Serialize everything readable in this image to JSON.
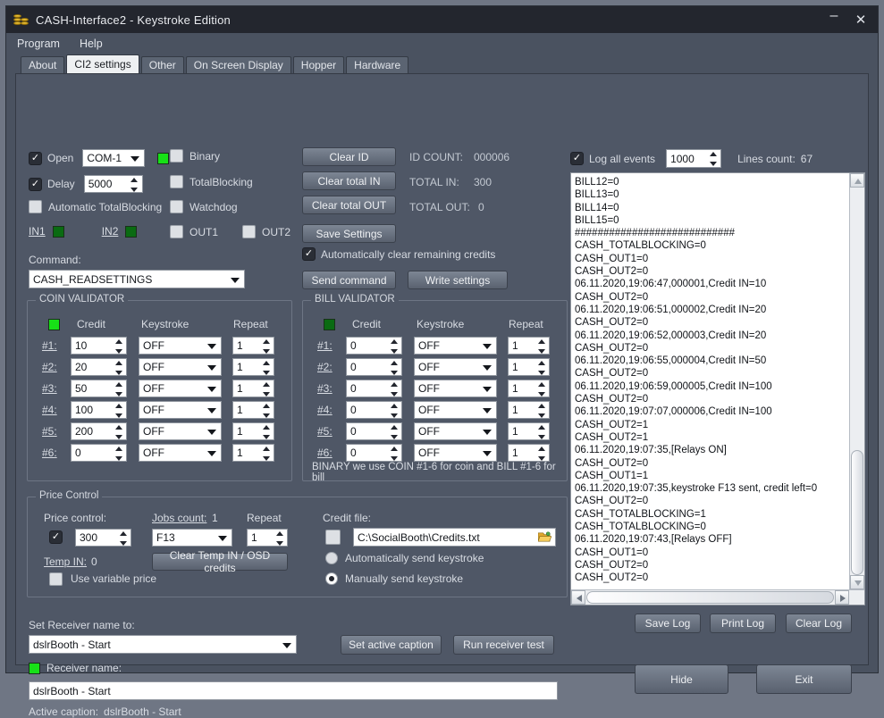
{
  "window": {
    "title": "CASH-Interface2 - Keystroke Edition",
    "icon": "coin-stack-icon",
    "minimize": "–",
    "close": "✕"
  },
  "menu": {
    "items": [
      "Program",
      "Help"
    ]
  },
  "tabs": {
    "items": [
      "About",
      "CI2 settings",
      "Other",
      "On Screen Display",
      "Hopper",
      "Hardware"
    ],
    "active": "CI2 settings"
  },
  "connection": {
    "open_label": "Open",
    "open_checked": "✓",
    "port_value": "COM-1",
    "port_led": "on",
    "delay_label": "Delay",
    "delay_checked": "✓",
    "delay_value": "5000",
    "auto_totalblocking_label": "Automatic TotalBlocking",
    "in1_label": "IN1",
    "in2_label": "IN2",
    "binary_label": "Binary",
    "totalblocking_label": "TotalBlocking",
    "watchdog_label": "Watchdog",
    "out1_label": "OUT1",
    "out2_label": "OUT2",
    "command_label": "Command:",
    "command_value": "CASH_READSETTINGS"
  },
  "actions": {
    "clear_id": "Clear ID",
    "clear_total_in": "Clear total IN",
    "clear_total_out": "Clear total OUT",
    "save_settings": "Save Settings",
    "auto_clear_label": "Automatically clear remaining credits",
    "auto_clear_checked": "✓",
    "send_command": "Send command",
    "write_settings": "Write settings"
  },
  "counters": {
    "id_count_label": "ID COUNT:",
    "id_count_value": "000006",
    "total_in_label": "TOTAL IN:",
    "total_in_value": "300",
    "total_out_label": "TOTAL OUT:",
    "total_out_value": "0"
  },
  "coin_validator": {
    "title": "COIN VALIDATOR",
    "led": "on",
    "headers": {
      "credit": "Credit",
      "keystroke": "Keystroke",
      "repeat": "Repeat"
    },
    "rows": [
      {
        "label": "#1:",
        "credit": "10",
        "keystroke": "OFF",
        "repeat": "1"
      },
      {
        "label": "#2:",
        "credit": "20",
        "keystroke": "OFF",
        "repeat": "1"
      },
      {
        "label": "#3:",
        "credit": "50",
        "keystroke": "OFF",
        "repeat": "1"
      },
      {
        "label": "#4:",
        "credit": "100",
        "keystroke": "OFF",
        "repeat": "1"
      },
      {
        "label": "#5:",
        "credit": "200",
        "keystroke": "OFF",
        "repeat": "1"
      },
      {
        "label": "#6:",
        "credit": "0",
        "keystroke": "OFF",
        "repeat": "1"
      }
    ]
  },
  "bill_validator": {
    "title": "BILL VALIDATOR",
    "led": "dim",
    "headers": {
      "credit": "Credit",
      "keystroke": "Keystroke",
      "repeat": "Repeat"
    },
    "rows": [
      {
        "label": "#1:",
        "credit": "0",
        "keystroke": "OFF",
        "repeat": "1"
      },
      {
        "label": "#2:",
        "credit": "0",
        "keystroke": "OFF",
        "repeat": "1"
      },
      {
        "label": "#3:",
        "credit": "0",
        "keystroke": "OFF",
        "repeat": "1"
      },
      {
        "label": "#4:",
        "credit": "0",
        "keystroke": "OFF",
        "repeat": "1"
      },
      {
        "label": "#5:",
        "credit": "0",
        "keystroke": "OFF",
        "repeat": "1"
      },
      {
        "label": "#6:",
        "credit": "0",
        "keystroke": "OFF",
        "repeat": "1"
      }
    ],
    "note": "BINARY we use COIN #1-6 for coin and BILL #1-6 for bill"
  },
  "price_control": {
    "title": "Price Control",
    "price_label": "Price control:",
    "price_checked": "✓",
    "price_value": "300",
    "jobs_label": "Jobs count:",
    "jobs_value": "1",
    "keystroke_value": "F13",
    "repeat_label": "Repeat",
    "repeat_value": "1",
    "temp_in_label": "Temp IN:",
    "temp_in_value": "0",
    "clear_temp": "Clear Temp IN / OSD credits",
    "variable_price_label": "Use variable price",
    "credit_file_label": "Credit file:",
    "credit_file_value": "C:\\SocialBooth\\Credits.txt",
    "auto_send_label": "Automatically send keystroke",
    "manual_send_label": "Manually send keystroke",
    "send_mode": "manual"
  },
  "receiver": {
    "set_name_label": "Set Receiver name to:",
    "set_name_value": "dslrBooth - Start",
    "name_label": "Receiver name:",
    "name_led": "on",
    "name_value": "dslrBooth - Start",
    "active_caption_label": "Active caption:",
    "active_caption_value": "dslrBooth - Start",
    "set_active_caption": "Set active caption",
    "run_receiver_test": "Run receiver test"
  },
  "log": {
    "log_all_label": "Log all events",
    "log_all_checked": "✓",
    "max_lines": "1000",
    "lines_count_label": "Lines count:",
    "lines_count_value": "67",
    "lines": [
      "BILL12=0",
      "BILL13=0",
      "BILL14=0",
      "BILL15=0",
      "############################",
      "CASH_TOTALBLOCKING=0",
      "CASH_OUT1=0",
      "CASH_OUT2=0",
      "06.11.2020,19:06:47,000001,Credit IN=10",
      "CASH_OUT2=0",
      "06.11.2020,19:06:51,000002,Credit IN=20",
      "CASH_OUT2=0",
      "06.11.2020,19:06:52,000003,Credit IN=20",
      "CASH_OUT2=0",
      "06.11.2020,19:06:55,000004,Credit IN=50",
      "CASH_OUT2=0",
      "06.11.2020,19:06:59,000005,Credit IN=100",
      "CASH_OUT2=0",
      "06.11.2020,19:07:07,000006,Credit IN=100",
      "CASH_OUT2=1",
      "CASH_OUT2=1",
      "06.11.2020,19:07:35,[Relays ON]",
      "CASH_OUT2=0",
      "CASH_OUT1=1",
      "06.11.2020,19:07:35,keystroke F13 sent, credit left=0",
      "CASH_OUT2=0",
      "CASH_TOTALBLOCKING=1",
      "CASH_TOTALBLOCKING=0",
      "06.11.2020,19:07:43,[Relays OFF]",
      "CASH_OUT1=0",
      "CASH_OUT2=0",
      "CASH_OUT2=0"
    ],
    "save_log": "Save Log",
    "print_log": "Print Log",
    "clear_log": "Clear Log"
  },
  "footer": {
    "hide": "Hide",
    "exit": "Exit"
  }
}
